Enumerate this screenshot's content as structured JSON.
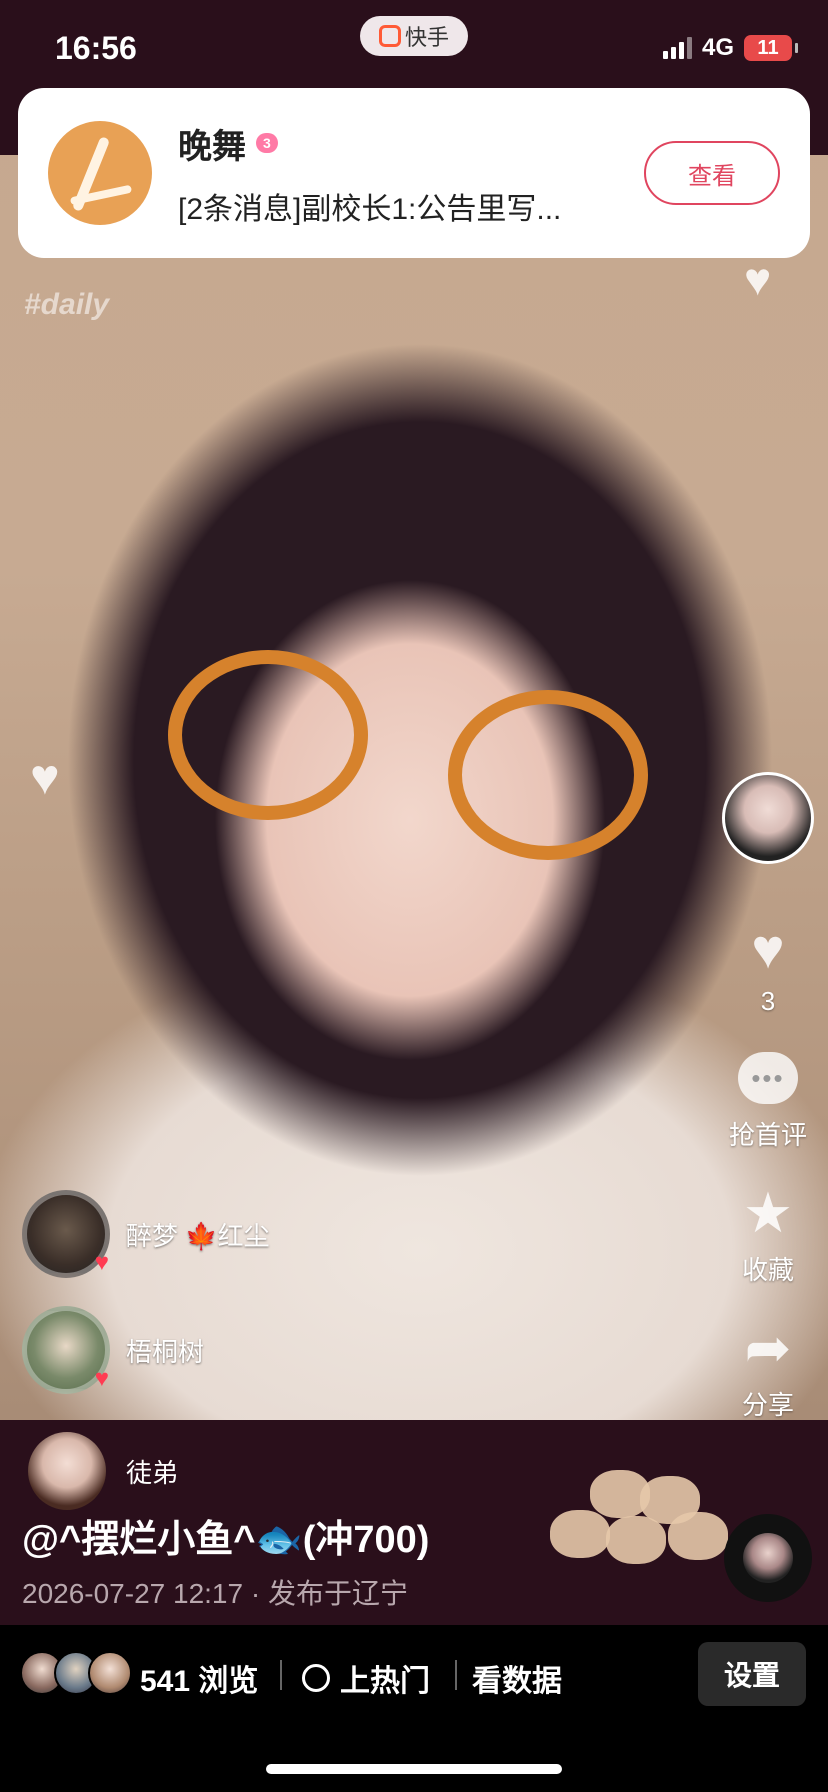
{
  "status_bar": {
    "time": "16:56",
    "app_name": "快手",
    "network": "4G",
    "battery": "11"
  },
  "notification": {
    "sender": "晚舞",
    "level_badge": "3",
    "message": "[2条消息]副校长1:公告里写...",
    "action_label": "查看"
  },
  "video": {
    "overlay_tag": "#daily"
  },
  "actions": {
    "likes_count": "3",
    "comment_label": "抢首评",
    "favorite_label": "收藏",
    "share_label": "分享"
  },
  "likers": [
    {
      "name": "醉梦 🍁红尘"
    },
    {
      "name": "梧桐树"
    }
  ],
  "apprentice": {
    "name": "徒弟"
  },
  "caption": "@^摆烂小鱼^🐟(冲700)",
  "meta": "2026-07-27 12:17 · 发布于辽宁",
  "bottom_bar": {
    "views": "541 浏览",
    "hot_label": "上热门",
    "data_label": "看数据",
    "settings_label": "设置"
  },
  "colors": {
    "accent": "#e0455f",
    "panel_bg": "#2a0f1b",
    "battery_low": "#e84a4a"
  }
}
